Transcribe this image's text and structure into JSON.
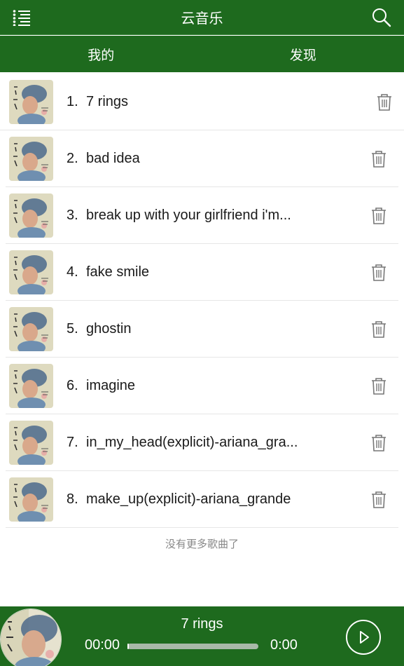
{
  "header": {
    "title": "云音乐",
    "menu_icon": "list-menu-icon",
    "search_icon": "search-icon"
  },
  "tabs": [
    {
      "label": "我的"
    },
    {
      "label": "发现"
    }
  ],
  "songs": [
    {
      "num": "1.",
      "title": "7 rings"
    },
    {
      "num": "2.",
      "title": "bad idea"
    },
    {
      "num": "3.",
      "title": "break up with your girlfriend i'm..."
    },
    {
      "num": "4.",
      "title": "fake smile"
    },
    {
      "num": "5.",
      "title": "ghostin"
    },
    {
      "num": "6.",
      "title": "imagine"
    },
    {
      "num": "7.",
      "title": "in_my_head(explicit)-ariana_gra..."
    },
    {
      "num": "8.",
      "title": "make_up(explicit)-ariana_grande"
    }
  ],
  "list_footer": "没有更多歌曲了",
  "player": {
    "title": "7 rings",
    "current_time": "00:00",
    "total_time": "0:00",
    "progress": 0.0
  },
  "colors": {
    "primary": "#1e6a1e",
    "divider": "#e6e6e6"
  }
}
